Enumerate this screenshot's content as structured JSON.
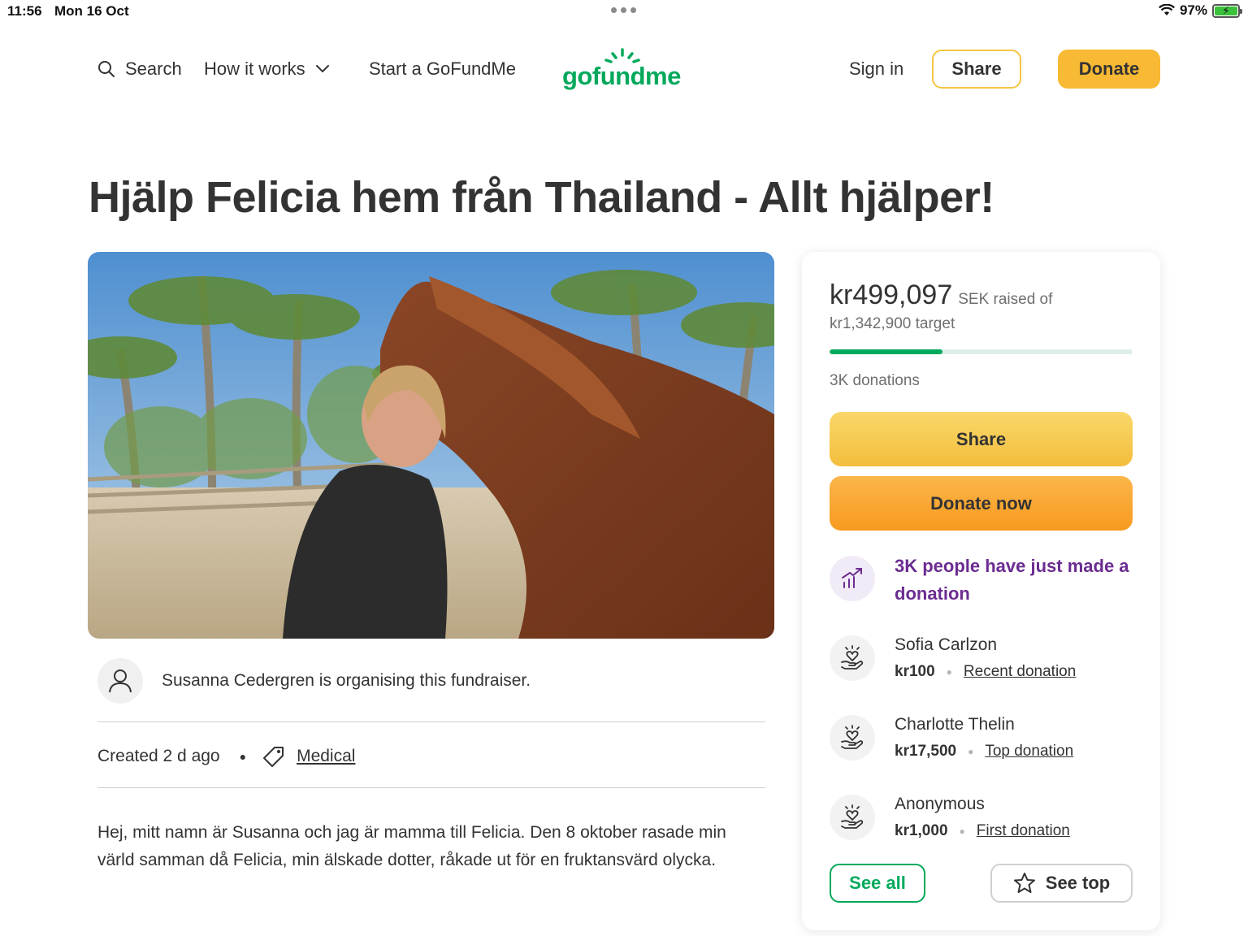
{
  "status_bar": {
    "time": "11:56",
    "date": "Mon 16 Oct",
    "battery": "97%"
  },
  "nav": {
    "search": "Search",
    "how_it_works": "How it works",
    "start": "Start a GoFundMe",
    "logo": "gofundme",
    "sign_in": "Sign in",
    "share": "Share",
    "donate": "Donate"
  },
  "campaign": {
    "title": "Hjälp Felicia hem från Thailand - Allt hjälper!",
    "organiser": "Susanna Cedergren is organising this fundraiser.",
    "created": "Created 2 d ago",
    "category": "Medical",
    "story": [
      "Hej, mitt namn är Susanna och jag är mamma till Felicia. Den 8 oktober rasade min värld samman då Felicia, min älskade dotter, råkade ut för en fruktansvärd olycka."
    ]
  },
  "summary": {
    "raised": "kr499,097",
    "raised_suffix": "SEK raised of",
    "target": "kr1,342,900 target",
    "progress_fraction": 0.372,
    "donations": "3K donations",
    "share": "Share",
    "donate_now": "Donate now",
    "trend": "3K people have just made a donation"
  },
  "donors": [
    {
      "name": "Sofia Carlzon",
      "amount": "kr100",
      "kind": "Recent donation"
    },
    {
      "name": "Charlotte Thelin",
      "amount": "kr17,500",
      "kind": "Top donation"
    },
    {
      "name": "Anonymous",
      "amount": "kr1,000",
      "kind": "First donation"
    }
  ],
  "buttons": {
    "see_all": "See all",
    "see_top": "See top"
  },
  "colors": {
    "brand_green": "#02a95c",
    "donate_yellow": "#f8b934",
    "trend_purple": "#6b2c91"
  },
  "icons": [
    "search-icon",
    "chevron-down-icon",
    "user-icon",
    "tag-icon",
    "trend-up-icon",
    "heart-hand-icon",
    "star-icon",
    "wifi-icon",
    "battery-icon"
  ]
}
